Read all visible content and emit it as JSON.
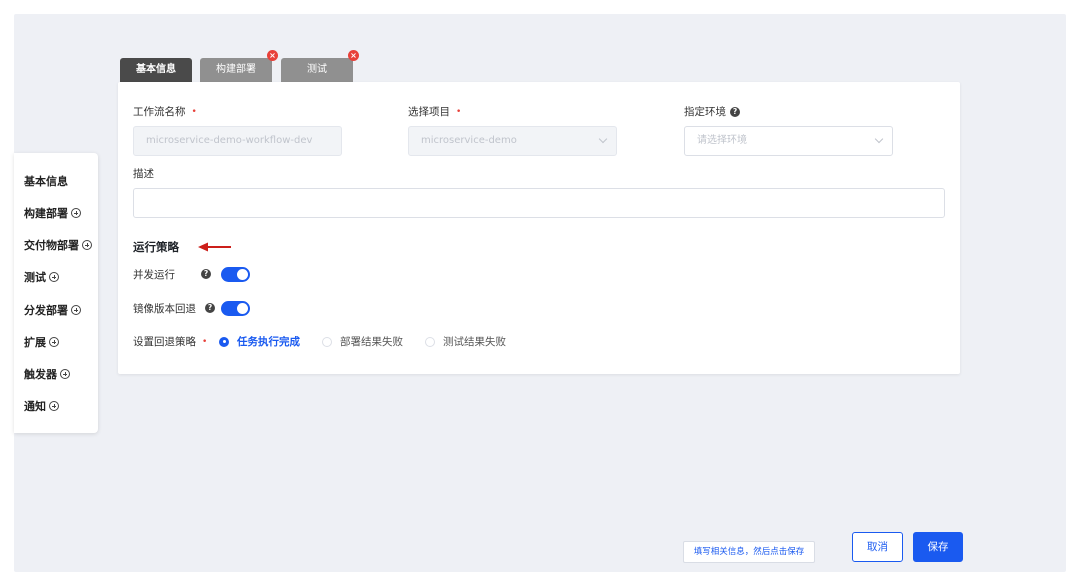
{
  "tabs": [
    {
      "label": "基本信息",
      "active": true,
      "closable": false
    },
    {
      "label": "构建部署",
      "active": false,
      "closable": true
    },
    {
      "label": "测试",
      "active": false,
      "closable": true
    }
  ],
  "sidebar": {
    "items": [
      {
        "label": "基本信息",
        "addable": false
      },
      {
        "label": "构建部署",
        "addable": true
      },
      {
        "label": "交付物部署",
        "addable": true
      },
      {
        "label": "测试",
        "addable": true
      },
      {
        "label": "分发部署",
        "addable": true
      },
      {
        "label": "扩展",
        "addable": true
      },
      {
        "label": "触发器",
        "addable": true
      },
      {
        "label": "通知",
        "addable": true
      }
    ]
  },
  "form": {
    "workflow_name": {
      "label": "工作流名称",
      "value": "microservice-demo-workflow-dev",
      "required": "•"
    },
    "project": {
      "label": "选择项目",
      "value": "microservice-demo",
      "required": "•"
    },
    "env": {
      "label": "指定环境",
      "placeholder": "请选择环境",
      "help": "?"
    },
    "description": {
      "label": "描述",
      "value": ""
    }
  },
  "strategy": {
    "title": "运行策略",
    "concurrent": {
      "label": "并发运行",
      "help": "?",
      "enabled": true
    },
    "rollback": {
      "label": "镜像版本回退",
      "help": "?",
      "enabled": true
    },
    "rollback_policy": {
      "label": "设置回退策略",
      "required": "•",
      "options": [
        "任务执行完成",
        "部署结果失败",
        "测试结果失败"
      ],
      "selected": "任务执行完成"
    }
  },
  "footer": {
    "hint": "填写相关信息，然后点击保存",
    "cancel_label": "取消",
    "save_label": "保存"
  },
  "colors": {
    "primary": "#1a5af0",
    "required": "#e8413a",
    "tab_active": "#4a4a4a",
    "tab_inactive": "#909090"
  }
}
